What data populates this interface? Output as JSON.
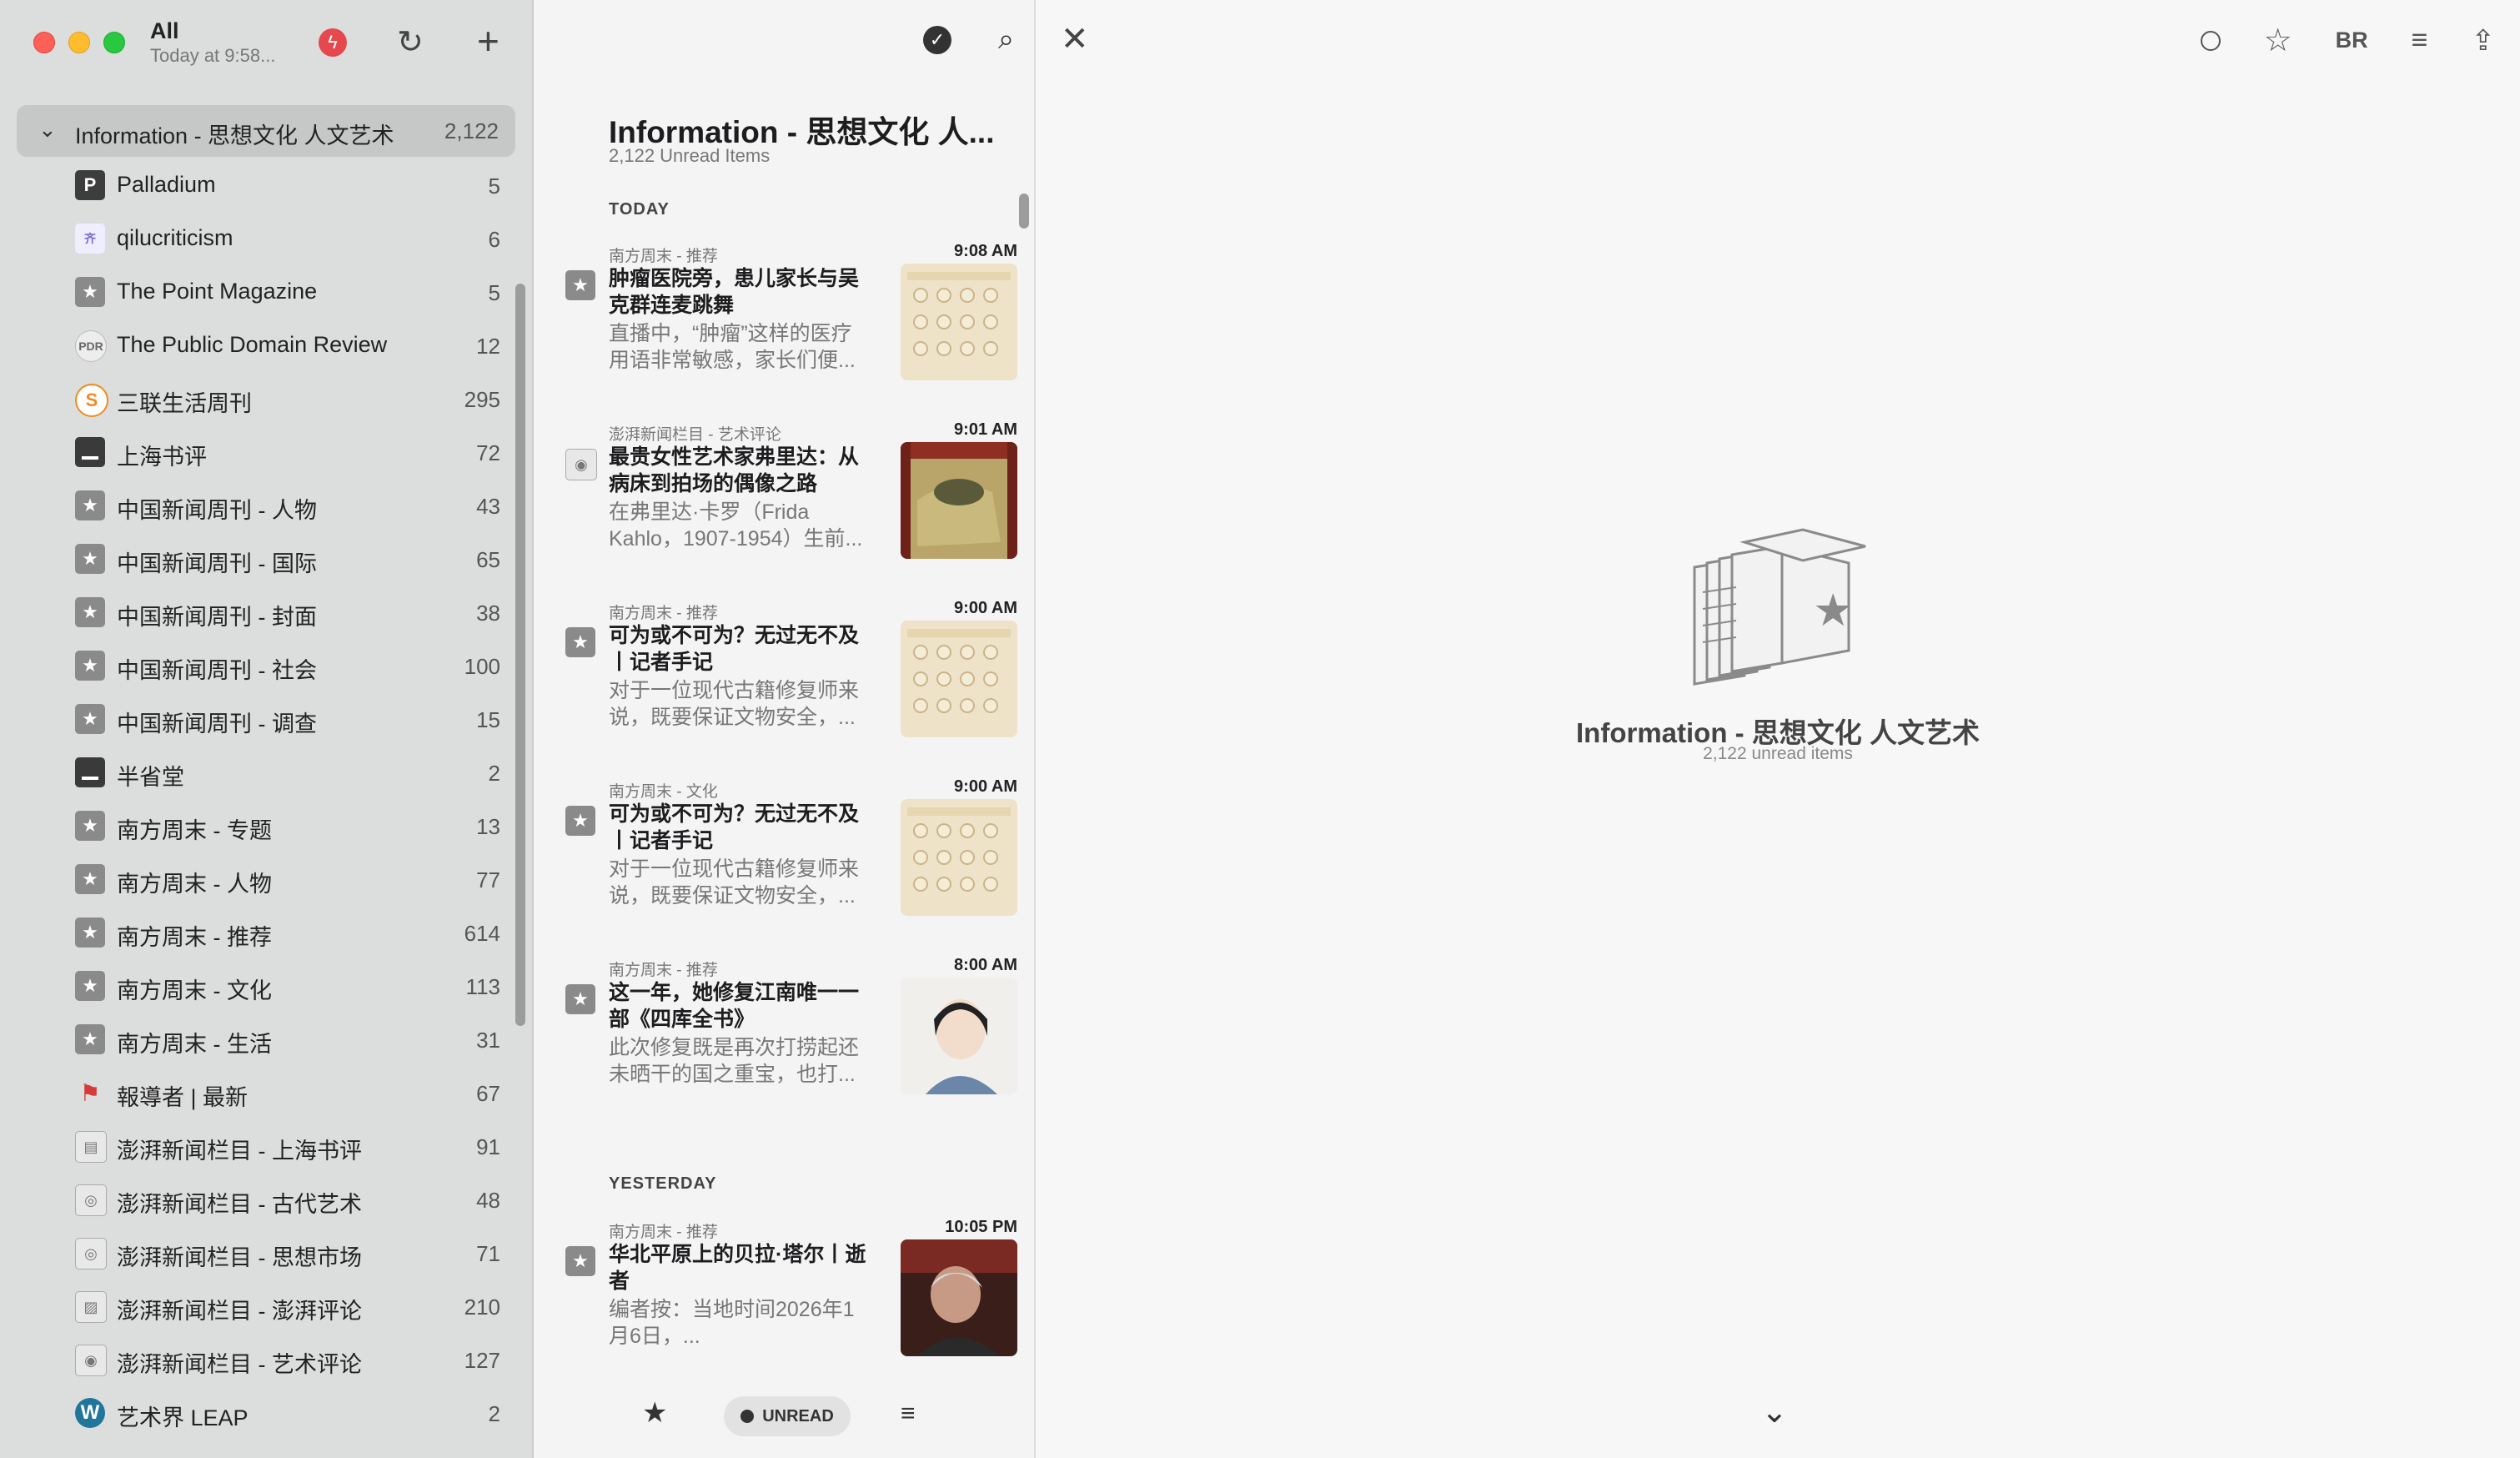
{
  "sidebar": {
    "title": "All",
    "subtitle": "Today at 9:58...",
    "folder": {
      "name": "Information - 思想文化 人文艺术",
      "count": "2,122"
    },
    "feeds": [
      {
        "name": "Palladium",
        "count": "5",
        "icon": "P",
        "style": "ic-dark"
      },
      {
        "name": "qilucriticism",
        "count": "6",
        "icon": "齐",
        "style": "ic-violet"
      },
      {
        "name": "The Point Magazine",
        "count": "5",
        "icon": "★",
        "style": "ic-star"
      },
      {
        "name": "The Public Domain Review",
        "count": "12",
        "icon": "PDR",
        "style": "ic-ring"
      },
      {
        "name": "三联生活周刊",
        "count": "295",
        "icon": "S",
        "style": "ic-orange"
      },
      {
        "name": "上海书评",
        "count": "72",
        "icon": "",
        "style": "ic-bar"
      },
      {
        "name": "中国新闻周刊 - 人物",
        "count": "43",
        "icon": "★",
        "style": "ic-star"
      },
      {
        "name": "中国新闻周刊 - 国际",
        "count": "65",
        "icon": "★",
        "style": "ic-star"
      },
      {
        "name": "中国新闻周刊 - 封面",
        "count": "38",
        "icon": "★",
        "style": "ic-star"
      },
      {
        "name": "中国新闻周刊 - 社会",
        "count": "100",
        "icon": "★",
        "style": "ic-star"
      },
      {
        "name": "中国新闻周刊 - 调查",
        "count": "15",
        "icon": "★",
        "style": "ic-star"
      },
      {
        "name": "半省堂",
        "count": "2",
        "icon": "",
        "style": "ic-bar"
      },
      {
        "name": "南方周末 - 专题",
        "count": "13",
        "icon": "★",
        "style": "ic-star"
      },
      {
        "name": "南方周末 - 人物",
        "count": "77",
        "icon": "★",
        "style": "ic-star"
      },
      {
        "name": "南方周末 - 推荐",
        "count": "614",
        "icon": "★",
        "style": "ic-star"
      },
      {
        "name": "南方周末 - 文化",
        "count": "113",
        "icon": "★",
        "style": "ic-star"
      },
      {
        "name": "南方周末 - 生活",
        "count": "31",
        "icon": "★",
        "style": "ic-star"
      },
      {
        "name": "報導者 | 最新",
        "count": "67",
        "icon": "⚑",
        "style": "ic-flag"
      },
      {
        "name": "澎湃新闻栏目 - 上海书评",
        "count": "91",
        "icon": "▤",
        "style": "ic-doc"
      },
      {
        "name": "澎湃新闻栏目 - 古代艺术",
        "count": "48",
        "icon": "◎",
        "style": "ic-doc"
      },
      {
        "name": "澎湃新闻栏目 - 思想市场",
        "count": "71",
        "icon": "◎",
        "style": "ic-doc"
      },
      {
        "name": "澎湃新闻栏目 - 澎湃评论",
        "count": "210",
        "icon": "▨",
        "style": "ic-doc"
      },
      {
        "name": "澎湃新闻栏目 - 艺术评论",
        "count": "127",
        "icon": "◉",
        "style": "ic-doc"
      },
      {
        "name": "艺术界 LEAP",
        "count": "2",
        "icon": "W",
        "style": "ic-wp"
      }
    ]
  },
  "list": {
    "title": "Information - 思想文化 人...",
    "unread": "2,122 Unread Items",
    "section_today": "TODAY",
    "section_yesterday": "YESTERDAY",
    "articles": [
      {
        "source": "南方周末 - 推荐",
        "time": "9:08 AM",
        "title": "肿瘤医院旁，患儿家长与吴克群连麦跳舞",
        "snippet": "直播中，“肿瘤”这样的医疗用语非常敏感，家长们便...",
        "thumb": "grid",
        "icon": "★"
      },
      {
        "source": "澎湃新闻栏目 - 艺术评论",
        "time": "9:01 AM",
        "title": "最贵女性艺术家弗里达：从病床到拍场的偶像之路",
        "snippet": "在弗里达·卡罗（Frida Kahlo，1907-1954）生前...",
        "thumb": "painting",
        "icon": "◉"
      },
      {
        "source": "南方周末 - 推荐",
        "time": "9:00 AM",
        "title": "可为或不可为？无过无不及丨记者手记",
        "snippet": "对于一位现代古籍修复师来说，既要保证文物安全，...",
        "thumb": "grid",
        "icon": "★"
      },
      {
        "source": "南方周末 - 文化",
        "time": "9:00 AM",
        "title": "可为或不可为？无过无不及丨记者手记",
        "snippet": "对于一位现代古籍修复师来说，既要保证文物安全，...",
        "thumb": "grid",
        "icon": "★"
      },
      {
        "source": "南方周末 - 推荐",
        "time": "8:00 AM",
        "title": "这一年，她修复江南唯一一部《四库全书》",
        "snippet": "此次修复既是再次打捞起还未晒干的国之重宝，也打...",
        "thumb": "portrait",
        "icon": "★"
      },
      {
        "source": "南方周末 - 推荐",
        "time": "10:05 PM",
        "title": "华北平原上的贝拉·塔尔丨逝者",
        "snippet": "编者按：当地时间2026年1月6日，...",
        "thumb": "photo",
        "icon": "★"
      }
    ],
    "bottom": {
      "unread_label": "UNREAD"
    }
  },
  "reader": {
    "br_label": "BR",
    "empty_title": "Information - 思想文化 人文艺术",
    "empty_sub": "2,122 unread items"
  }
}
